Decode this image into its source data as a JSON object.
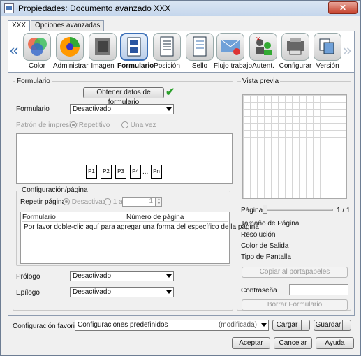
{
  "window": {
    "title": "Propiedades: Documento avanzado XXX",
    "close": "✕"
  },
  "tabs": [
    "XXX",
    "Opciones avanzadas"
  ],
  "toolbar": {
    "items": [
      "Color",
      "Administrar",
      "Imagen",
      "Formulario",
      "Posición",
      "Sello",
      "Flujo trabajo",
      "Autent.",
      "Configurar",
      "Versión"
    ],
    "selected": "Formulario"
  },
  "form": {
    "section_label": "Formulario",
    "get_data_button": "Obtener datos de formulario",
    "form_label": "Formulario",
    "form_value": "Desactivado",
    "print_pattern_label": "Patrón de impresión",
    "repeat_label": "Repetitivo",
    "once_label": "Una vez",
    "pages": [
      "P1",
      "P2",
      "P3",
      "P4",
      "...",
      "Pn"
    ],
    "config_section": "Configuración/página",
    "repeat_pages_label": "Repetir páginas",
    "repeat_off": "Desactivado",
    "range_from": "1 a",
    "range_value": "1",
    "table_cols": [
      "Formulario",
      "Número de página"
    ],
    "table_hint": "Por favor doble-clic aquí para agregar una forma del específico de la página",
    "prologue_label": "Prólogo",
    "prologue_value": "Desactivado",
    "epilogue_label": "Epílogo",
    "epilogue_value": "Desactivado"
  },
  "preview": {
    "label": "Vista previa",
    "page_label": "Página",
    "page_count": "1 / 1",
    "info": [
      "Tamaño de Página",
      "Resolución",
      "Color de Salida",
      "Tipo de Pantalla"
    ],
    "copy_button": "Copiar al portapapeles",
    "password_label": "Contraseña",
    "delete_button": "Borrar Formulario"
  },
  "favorites": {
    "label": "Configuración favorita",
    "value": "Configuraciones predefinidos",
    "modified": "(modificada)",
    "load": "Cargar",
    "save": "Guardar"
  },
  "buttons": {
    "ok": "Aceptar",
    "cancel": "Cancelar",
    "help": "Ayuda"
  }
}
